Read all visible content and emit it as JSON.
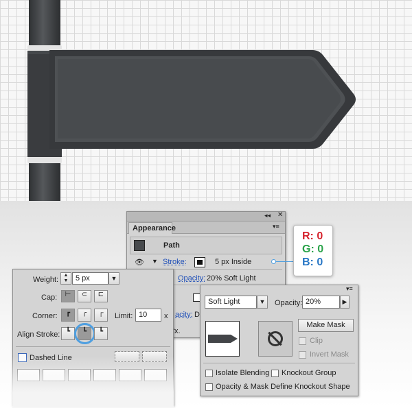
{
  "colors": {
    "sign_fill": "#434548",
    "sign_border": "#37393c",
    "sign_inner": "#4e5154",
    "stroke_badge": "#4f9fe0",
    "red": "#d6242e",
    "green": "#2aa34a",
    "blue": "#2a78c6"
  },
  "icons": [
    "eye-icon",
    "triangle-icon",
    "collapse-icon",
    "close-icon",
    "panel-menu-icon",
    "no-icon",
    "fx-icon"
  ],
  "appearance": {
    "tab": "Appearance",
    "path_label": "Path",
    "stroke_label": "Stroke:",
    "stroke_value": "5 px  Inside",
    "opacity_label": "Opacity:",
    "opacity_value": "20% Soft Light",
    "row3_label": "acity:",
    "row3_value": "De",
    "fx": "fx."
  },
  "stroke_panel": {
    "weight_label": "Weight:",
    "weight_value": "5 px",
    "cap_label": "Cap:",
    "corner_label": "Corner:",
    "limit_label": "Limit:",
    "limit_value": "10",
    "limit_unit": "x",
    "align_label": "Align Stroke:",
    "dashed_label": "Dashed Line"
  },
  "transparency": {
    "blend_mode": "Soft Light",
    "opacity_label": "Opacity:",
    "opacity_value": "20%",
    "make_mask": "Make Mask",
    "clip": "Clip",
    "invert_mask": "Invert Mask",
    "isolate": "Isolate Blending",
    "knockout": "Knockout Group",
    "opacity_mask": "Opacity & Mask Define Knockout Shape"
  },
  "rgb": {
    "r": "R: 0",
    "g": "G: 0",
    "b": "B: 0"
  }
}
